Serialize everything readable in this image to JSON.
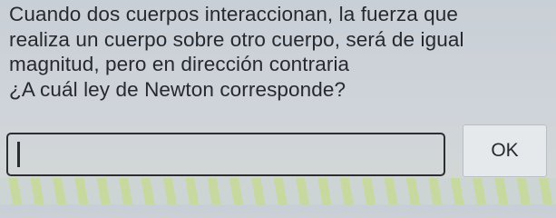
{
  "question": {
    "lines": [
      "Cuando dos cuerpos interaccionan, la fuerza que",
      "realiza un cuerpo sobre otro cuerpo, será de igual",
      "magnitud, pero en dirección contraria",
      "¿A cuál ley de Newton corresponde?"
    ]
  },
  "answer": {
    "value": "",
    "placeholder": ""
  },
  "ok_button": {
    "label": "OK"
  }
}
